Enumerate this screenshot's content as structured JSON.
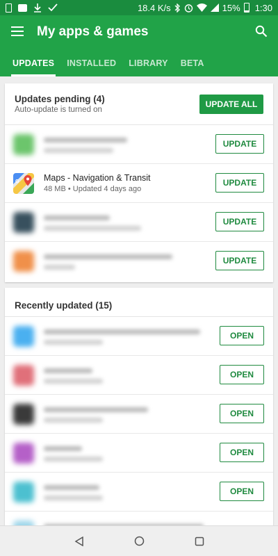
{
  "status_bar": {
    "speed": "18.4 K/s",
    "battery": "15%",
    "time": "1:30",
    "left_icons": [
      "sim-card-icon",
      "notification-icon",
      "download-icon",
      "check-icon"
    ],
    "right_icons": [
      "bluetooth-icon",
      "alarm-icon",
      "wifi-icon",
      "signal-icon",
      "battery-icon"
    ]
  },
  "app_bar": {
    "title": "My apps & games",
    "menu_icon": "menu-icon",
    "search_icon": "search-icon",
    "color": "#21a348",
    "status_color": "#1a8c3e"
  },
  "tabs": [
    {
      "label": "UPDATES",
      "active": true
    },
    {
      "label": "INSTALLED",
      "active": false
    },
    {
      "label": "LIBRARY",
      "active": false
    },
    {
      "label": "BETA",
      "active": false
    }
  ],
  "updates": {
    "title": "Updates pending (4)",
    "subtitle": "Auto-update is turned on",
    "update_all_label": "UPDATE ALL",
    "apps": [
      {
        "name": "",
        "meta": "",
        "blurred": true,
        "icon_color": "#6cc56c",
        "button": "UPDATE"
      },
      {
        "name": "Maps - Navigation & Transit",
        "meta": "48 MB • Updated 4 days ago",
        "blurred": false,
        "icon": "google-maps-icon",
        "button": "UPDATE"
      },
      {
        "name": "",
        "meta": "",
        "blurred": true,
        "icon_color": "#38505e",
        "button": "UPDATE"
      },
      {
        "name": "",
        "meta": "",
        "blurred": true,
        "icon_color": "#f0904a",
        "button": "UPDATE"
      }
    ]
  },
  "recent": {
    "title": "Recently updated (15)",
    "apps": [
      {
        "icon_color": "#4ab0f0",
        "button": "OPEN"
      },
      {
        "icon_color": "#e0707a",
        "button": "OPEN"
      },
      {
        "icon_color": "#3a3a3a",
        "button": "OPEN"
      },
      {
        "icon_color": "#b560c8",
        "button": "OPEN"
      },
      {
        "icon_color": "#4cc0d0",
        "button": "OPEN"
      }
    ]
  },
  "nav": {
    "back_icon": "back-icon",
    "home_icon": "home-icon",
    "recents_icon": "recents-icon"
  }
}
